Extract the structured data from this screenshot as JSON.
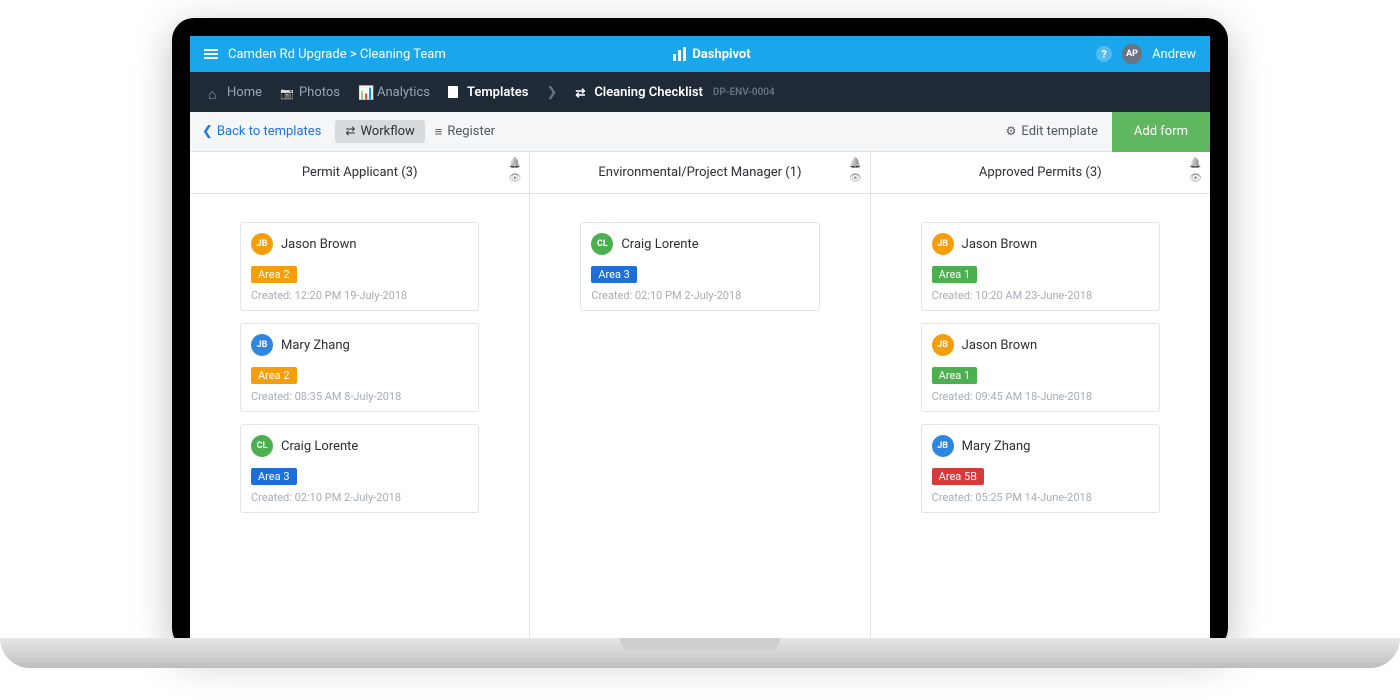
{
  "topbar": {
    "breadcrumb": "Camden Rd Upgrade > Cleaning Team",
    "brand": "Dashpivot",
    "user_initials": "AP",
    "user_name": "Andrew"
  },
  "nav": {
    "home": "Home",
    "photos": "Photos",
    "analytics": "Analytics",
    "templates": "Templates",
    "checklist": "Cleaning Checklist",
    "template_id": "DP-ENV-0004"
  },
  "toolbar": {
    "back": "Back to templates",
    "workflow": "Workflow",
    "register": "Register",
    "edit": "Edit template",
    "add": "Add form"
  },
  "columns": [
    {
      "title": "Permit Applicant (3)",
      "cards": [
        {
          "initials": "JB",
          "avatar": "av-orange",
          "name": "Jason Brown",
          "tag": "Area 2",
          "tag_cls": "t-orange",
          "meta": "Created: 12:20 PM 19-July-2018"
        },
        {
          "initials": "JB",
          "avatar": "av-blue",
          "name": "Mary Zhang",
          "tag": "Area 2",
          "tag_cls": "t-orange",
          "meta": "Created: 08:35 AM 8-July-2018"
        },
        {
          "initials": "CL",
          "avatar": "av-green",
          "name": "Craig Lorente",
          "tag": "Area 3",
          "tag_cls": "t-blue",
          "meta": "Created: 02:10 PM 2-July-2018"
        }
      ]
    },
    {
      "title": "Environmental/Project Manager (1)",
      "cards": [
        {
          "initials": "CL",
          "avatar": "av-green",
          "name": "Craig Lorente",
          "tag": "Area 3",
          "tag_cls": "t-blue",
          "meta": "Created: 02:10 PM 2-July-2018"
        }
      ]
    },
    {
      "title": "Approved Permits (3)",
      "cards": [
        {
          "initials": "JB",
          "avatar": "av-orange",
          "name": "Jason Brown",
          "tag": "Area 1",
          "tag_cls": "t-green",
          "meta": "Created: 10:20 AM 23-June-2018"
        },
        {
          "initials": "JB",
          "avatar": "av-orange",
          "name": "Jason Brown",
          "tag": "Area 1",
          "tag_cls": "t-green",
          "meta": "Created: 09:45 AM 18-June-2018"
        },
        {
          "initials": "JB",
          "avatar": "av-blue",
          "name": "Mary Zhang",
          "tag": "Area 5B",
          "tag_cls": "t-red",
          "meta": "Created: 05:25 PM 14-June-2018"
        }
      ]
    }
  ]
}
